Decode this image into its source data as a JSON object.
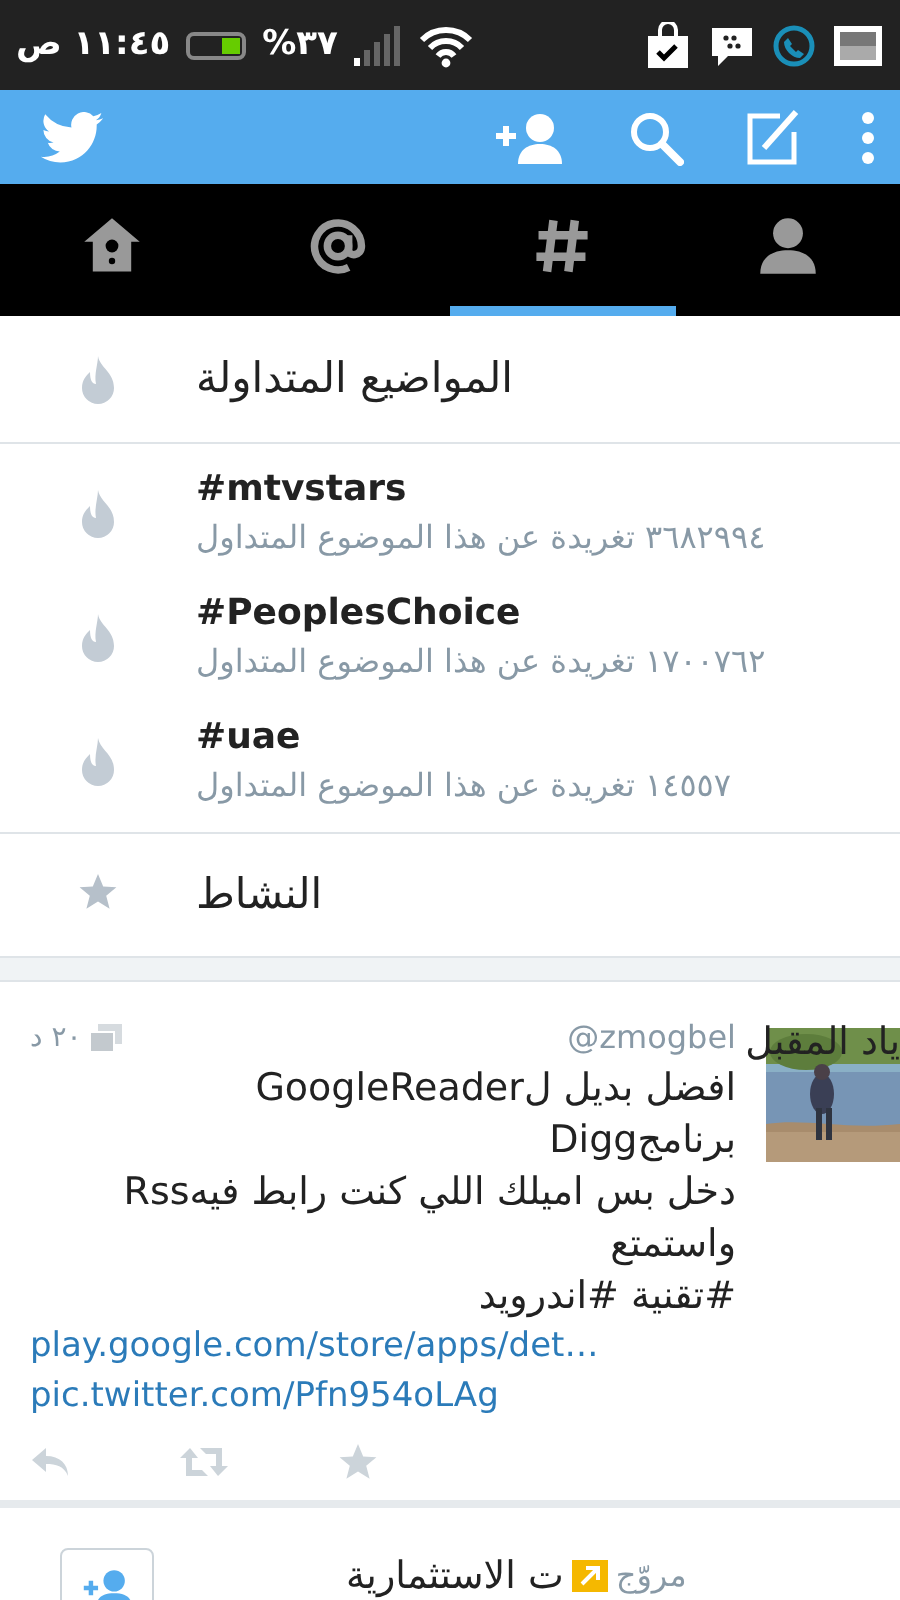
{
  "status_bar": {
    "time": "١١:٤٥ ص",
    "battery_percent": "%٣٧"
  },
  "tabs": [
    {
      "kind": "home",
      "selected": false
    },
    {
      "kind": "mentions",
      "selected": false
    },
    {
      "kind": "discover",
      "selected": true
    },
    {
      "kind": "me",
      "selected": false
    }
  ],
  "trends": {
    "title": "المواضيع المتداولة",
    "items": [
      {
        "hashtag": "#mtvstars",
        "count": "٣٦٨٢٩٩٤ تغريدة عن هذا الموضوع المتداول"
      },
      {
        "hashtag": "#PeoplesChoice",
        "count": "١٧٠٠٧٦٢ تغريدة عن هذا الموضوع المتداول"
      },
      {
        "hashtag": "#uae",
        "count": "١٤٥٥٧ تغريدة عن هذا الموضوع المتداول"
      }
    ]
  },
  "activity": {
    "title": "النشاط"
  },
  "tweet": {
    "name": "ياد المقبل",
    "handle": "@zmogbel",
    "time": "٢٠ د",
    "lines": [
      "افضل بديل لGoogleReader",
      "برنامجDigg",
      "دخل بس اميلك اللي كنت رابط فيهRss",
      "واستمتع",
      "#تقنية #اندرويد"
    ],
    "links": [
      "play.google.com/store/apps/det…",
      "pic.twitter.com/Pfn954oLAg"
    ]
  },
  "promoted": {
    "title": "ت الاستثمارية",
    "label": "مروّج"
  }
}
